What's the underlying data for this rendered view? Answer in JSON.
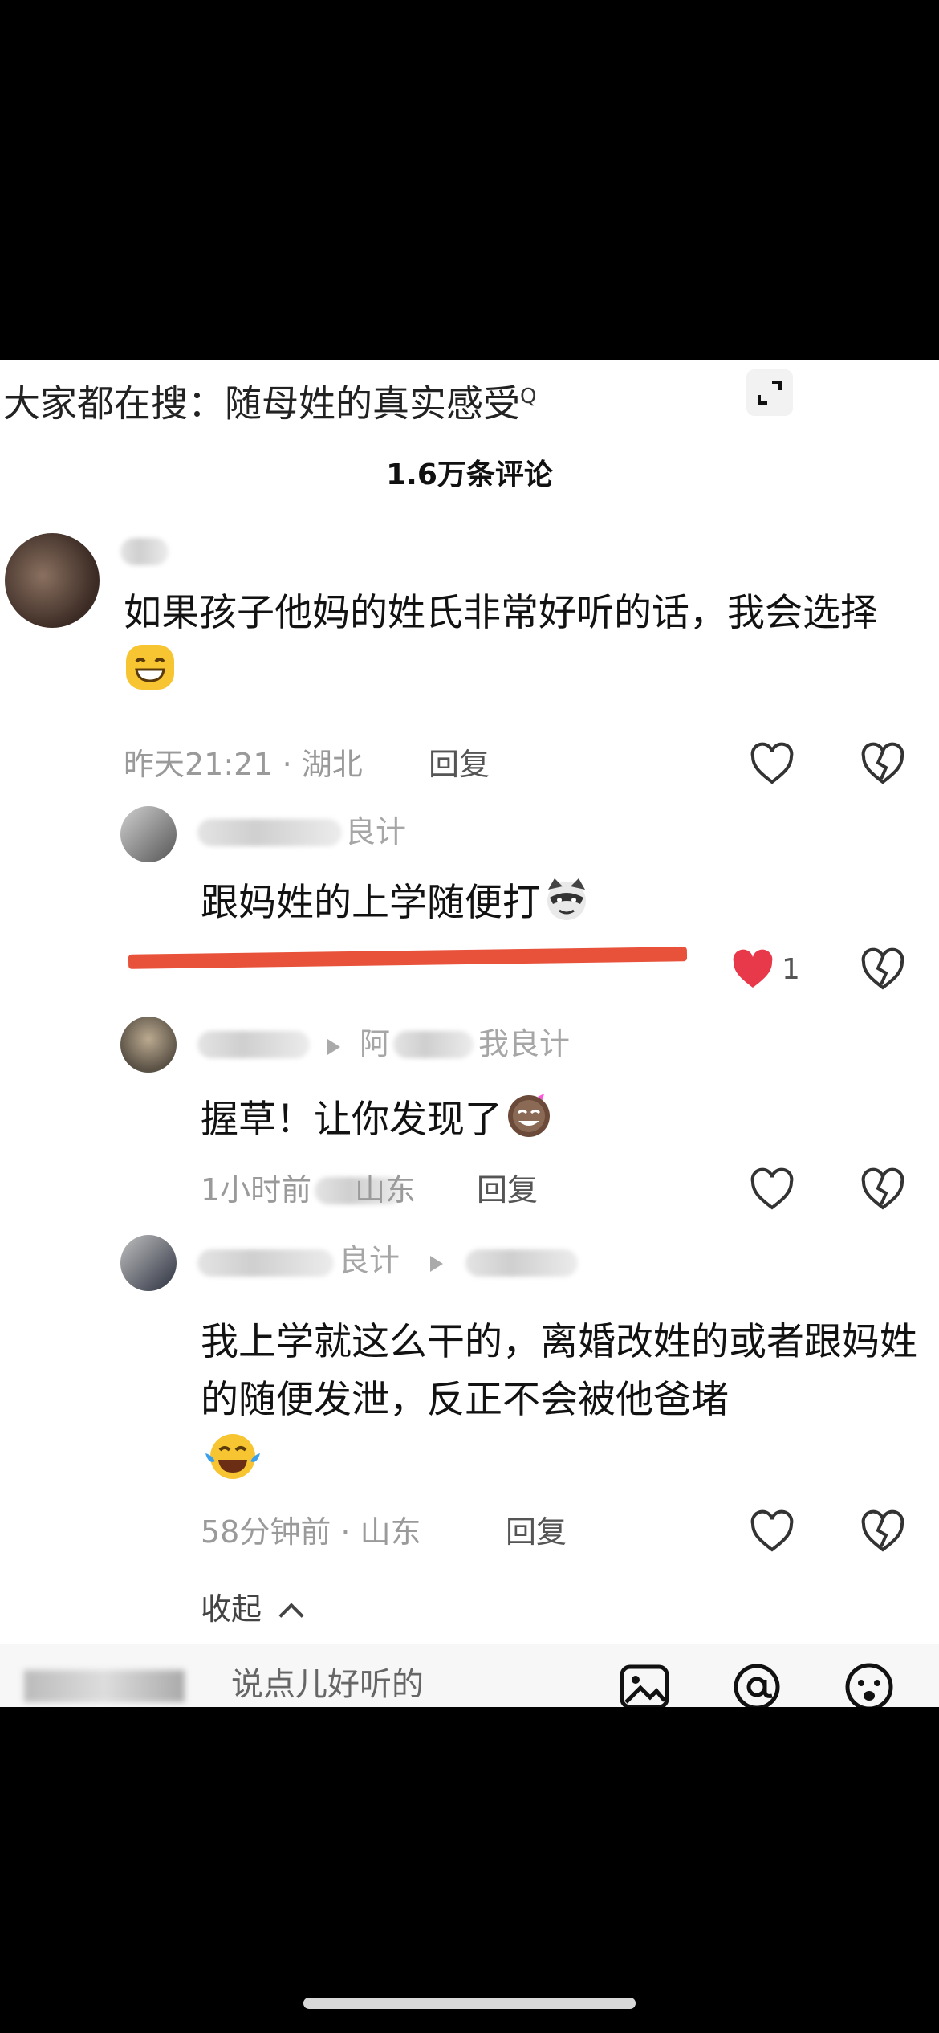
{
  "search": {
    "prefix": "大家都在搜：",
    "keyword": "随母姓的真实感受",
    "glass": "Q"
  },
  "comments_title": "1.6万条评论",
  "comments": [
    {
      "text": "如果孩子他妈的姓氏非常好听的话，我会选择",
      "time_location": "昨天21:21 · 湖北",
      "reply": "回复"
    },
    {
      "name_tail": "良计",
      "text": "跟妈姓的上学随便打",
      "like_count": "1"
    },
    {
      "name_tail": "阿",
      "reply_to": "我良计",
      "text": "握草！让你发现了",
      "time": "1小时前",
      "location": "山东",
      "reply": "回复"
    },
    {
      "name_tail": "良计",
      "text": "我上学就这么干的，离婚改姓的或者跟妈姓的随便发泄，反正不会被他爸堵",
      "time_location": "58分钟前 · 山东",
      "reply": "回复"
    }
  ],
  "collapse_label": "收起",
  "input": {
    "placeholder": "说点儿好听的"
  },
  "colors": {
    "liked_heart": "#e8394b",
    "red_strike": "#e8513a"
  }
}
